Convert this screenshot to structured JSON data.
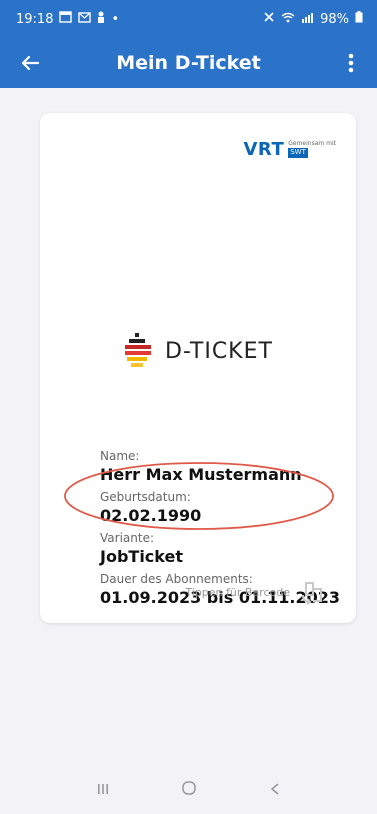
{
  "status": {
    "time": "19:18",
    "battery": "98%"
  },
  "app_bar": {
    "title": "Mein D-Ticket"
  },
  "card": {
    "operator": {
      "logo_text": "VRT",
      "partner_small": "Gemeinsam mit",
      "partner_tag": "SWT"
    },
    "brand_text": "D-TICKET",
    "fields": [
      {
        "label": "Name:",
        "value": "Herr Max Mustermann"
      },
      {
        "label": "Geburtsdatum:",
        "value": "02.02.1990"
      },
      {
        "label": "Variante:",
        "value": "JobTicket"
      },
      {
        "label": "Dauer des Abonnements:",
        "value": "01.09.2023 bis 01.11.2023"
      }
    ],
    "tap_hint": "Tippen für Barcode"
  },
  "colors": {
    "primary": "#2b73c9",
    "highlight": "#e05a4a"
  },
  "icons": [
    "back-arrow-icon",
    "more-vert-icon",
    "barcode-swap-icon",
    "recent-apps-icon",
    "home-icon",
    "back-nav-icon"
  ]
}
